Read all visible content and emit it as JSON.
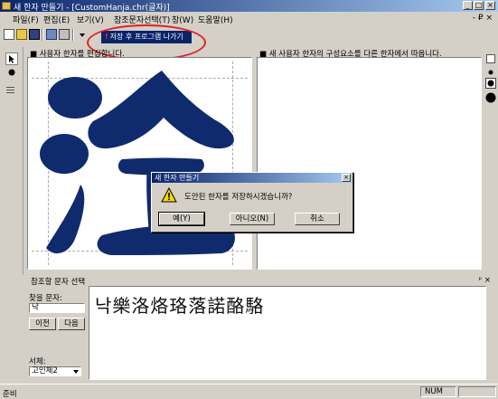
{
  "window": {
    "title": "새 한자 만들기 - [CustomHanja.chr(글자)]",
    "min": "_",
    "max": "□",
    "close": "×"
  },
  "menu": {
    "items": [
      "파일(F)",
      "편집(E)",
      "보기(V)",
      "참조문자선택(T)",
      "창(W)",
      "도움말(H)"
    ],
    "mdi_controls": "- ₽ ×"
  },
  "toolbar": {
    "tooltip_label": "저장 후 프로그램 나가기"
  },
  "left_panel": {
    "header": "■ 사용자 한자를 편집합니다."
  },
  "right_panel": {
    "header": "■ 새 사용자 한자의 구성요소를 다른 한자에서 따옵니다."
  },
  "dialog": {
    "title": "새 한자 만들기",
    "message": "도안된 한자를 저장하시겠습니까?",
    "buttons": [
      "예(Y)",
      "아니오(N)",
      "취소"
    ]
  },
  "reference": {
    "title": "참조할 문자 선택",
    "pane_controls": "ᵖ ×",
    "search_label": "찾을 문자:",
    "search_value": "낙",
    "prev_label": "이전",
    "next_label": "다음",
    "font_label": "서체:",
    "font_value": "고인체2",
    "chars": "낙樂洛烙珞落諾酪駱"
  },
  "status": {
    "text": "준비",
    "num": "NUM"
  },
  "colors": {
    "glyph": "#102a6e",
    "annotation": "#e02020",
    "titlebar": "#0a246a"
  }
}
